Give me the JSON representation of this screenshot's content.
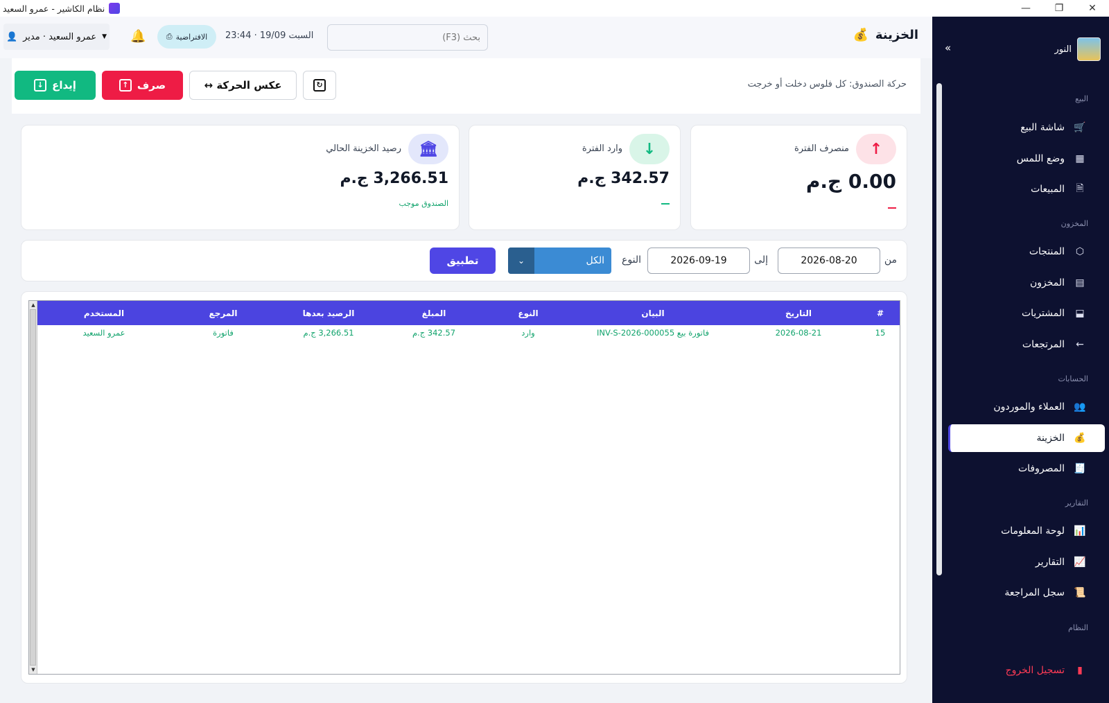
{
  "window": {
    "title": "نظام الكاشير - عمرو السعيد",
    "controls": {
      "minimize": "—",
      "maximize": "❐",
      "close": "✕"
    }
  },
  "sidebar": {
    "brand": "النور",
    "collapse_icon": "»",
    "sections": {
      "sales": "البيع",
      "inventory": "المخزون",
      "accounts": "الحسابات",
      "reports": "التقارير",
      "system": "النظام"
    },
    "items": [
      {
        "label": "شاشة البيع",
        "icon": "cart-icon"
      },
      {
        "label": "وضع اللمس",
        "icon": "calculator-icon"
      },
      {
        "label": "المبيعات",
        "icon": "document-icon"
      },
      {
        "label": "المنتجات",
        "icon": "box-icon"
      },
      {
        "label": "المخزون",
        "icon": "warehouse-icon"
      },
      {
        "label": "المشتريات",
        "icon": "purchase-icon"
      },
      {
        "label": "المرتجعات",
        "icon": "return-arrow-icon"
      },
      {
        "label": "العملاء والموردون",
        "icon": "people-icon"
      },
      {
        "label": "الخزينة",
        "icon": "money-bag-icon",
        "active": true
      },
      {
        "label": "المصروفات",
        "icon": "receipt-icon"
      },
      {
        "label": "لوحة المعلومات",
        "icon": "bar-chart-icon"
      },
      {
        "label": "التقارير",
        "icon": "chart-icon"
      },
      {
        "label": "سجل المراجعة",
        "icon": "scroll-icon"
      }
    ],
    "logout": "تسجيل الخروج"
  },
  "header": {
    "title": "الخزينة",
    "search_placeholder": "بحث (F3)",
    "datetime": "السبت 19/09 · 23:44",
    "printer": "الافتراضية",
    "user": "عمرو السعيد · مدير"
  },
  "actions": {
    "description": "حركة الصندوق: كل فلوس دخلت أو خرجت",
    "deposit": "إيداع",
    "withdraw": "صرف",
    "reverse": "عكس الحركة ↔"
  },
  "stats": {
    "outflow": {
      "label": "منصرف الفترة",
      "value": "0.00 ج.م"
    },
    "inflow": {
      "label": "وارد الفترة",
      "value": "342.57 ج.م"
    },
    "balance": {
      "label": "رصيد الخزينة الحالي",
      "value": "3,266.51 ج.م",
      "status": "الصندوق موجب"
    }
  },
  "filters": {
    "from_label": "من",
    "from_date": "2026-08-20",
    "to_label": "إلى",
    "to_date": "2026-09-19",
    "type_label": "النوع",
    "type_value": "الكل",
    "apply": "تطبيق"
  },
  "table": {
    "columns": [
      "#",
      "التاريخ",
      "البيان",
      "النوع",
      "المبلغ",
      "الرصيد بعدها",
      "المرجع",
      "المستخدم"
    ],
    "rows": [
      [
        "15",
        "2026-08-21",
        "فاتورة بيع INV-S-2026-000055",
        "وارد",
        "342.57 ج.م",
        "3,266.51 ج.م",
        "فاتورة",
        "عمرو السعيد"
      ]
    ]
  },
  "colors": {
    "sidebar_bg": "#0d1130",
    "accent": "#4f46e5",
    "deposit": "#11b981",
    "withdraw": "#ee1c45",
    "table_text": "#11a36c"
  }
}
